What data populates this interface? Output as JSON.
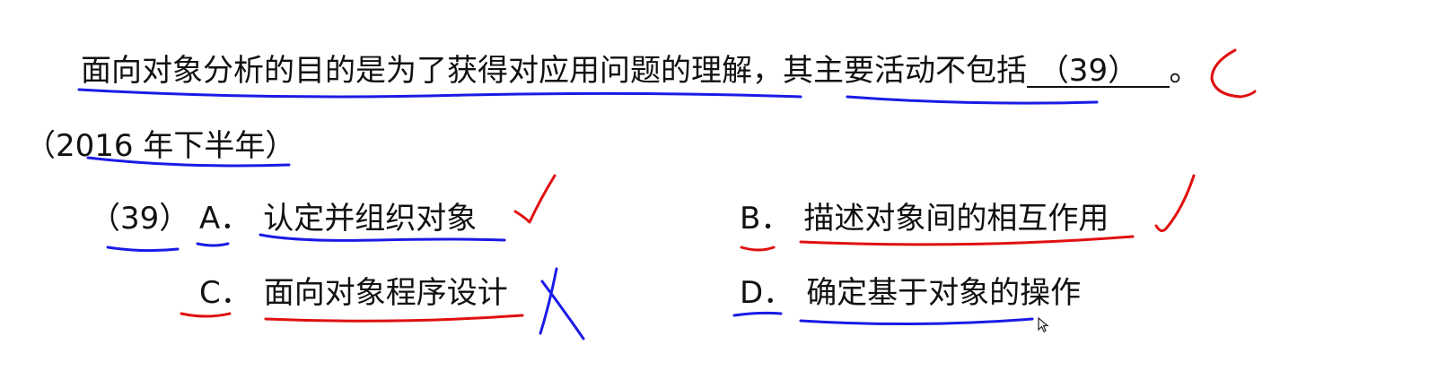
{
  "question": {
    "stem_part1": "面向对象分析的目的是为了获得对应用问题的理解，",
    "stem_part2": "其主要活动不包括",
    "blank": "（39）",
    "end_punct": "。",
    "source": "（2016 年下半年）"
  },
  "options": {
    "number": "（39）",
    "a": {
      "letter": "A．",
      "text": "认定并组织对象"
    },
    "b": {
      "letter": "B．",
      "text": "描述对象间的相互作用"
    },
    "c": {
      "letter": "C．",
      "text": "面向对象程序设计"
    },
    "d": {
      "letter": "D．",
      "text": "确定基于对象的操作"
    }
  },
  "colors": {
    "text": "#111111",
    "ink_blue": "#1a1ae6",
    "ink_red": "#e01010"
  }
}
